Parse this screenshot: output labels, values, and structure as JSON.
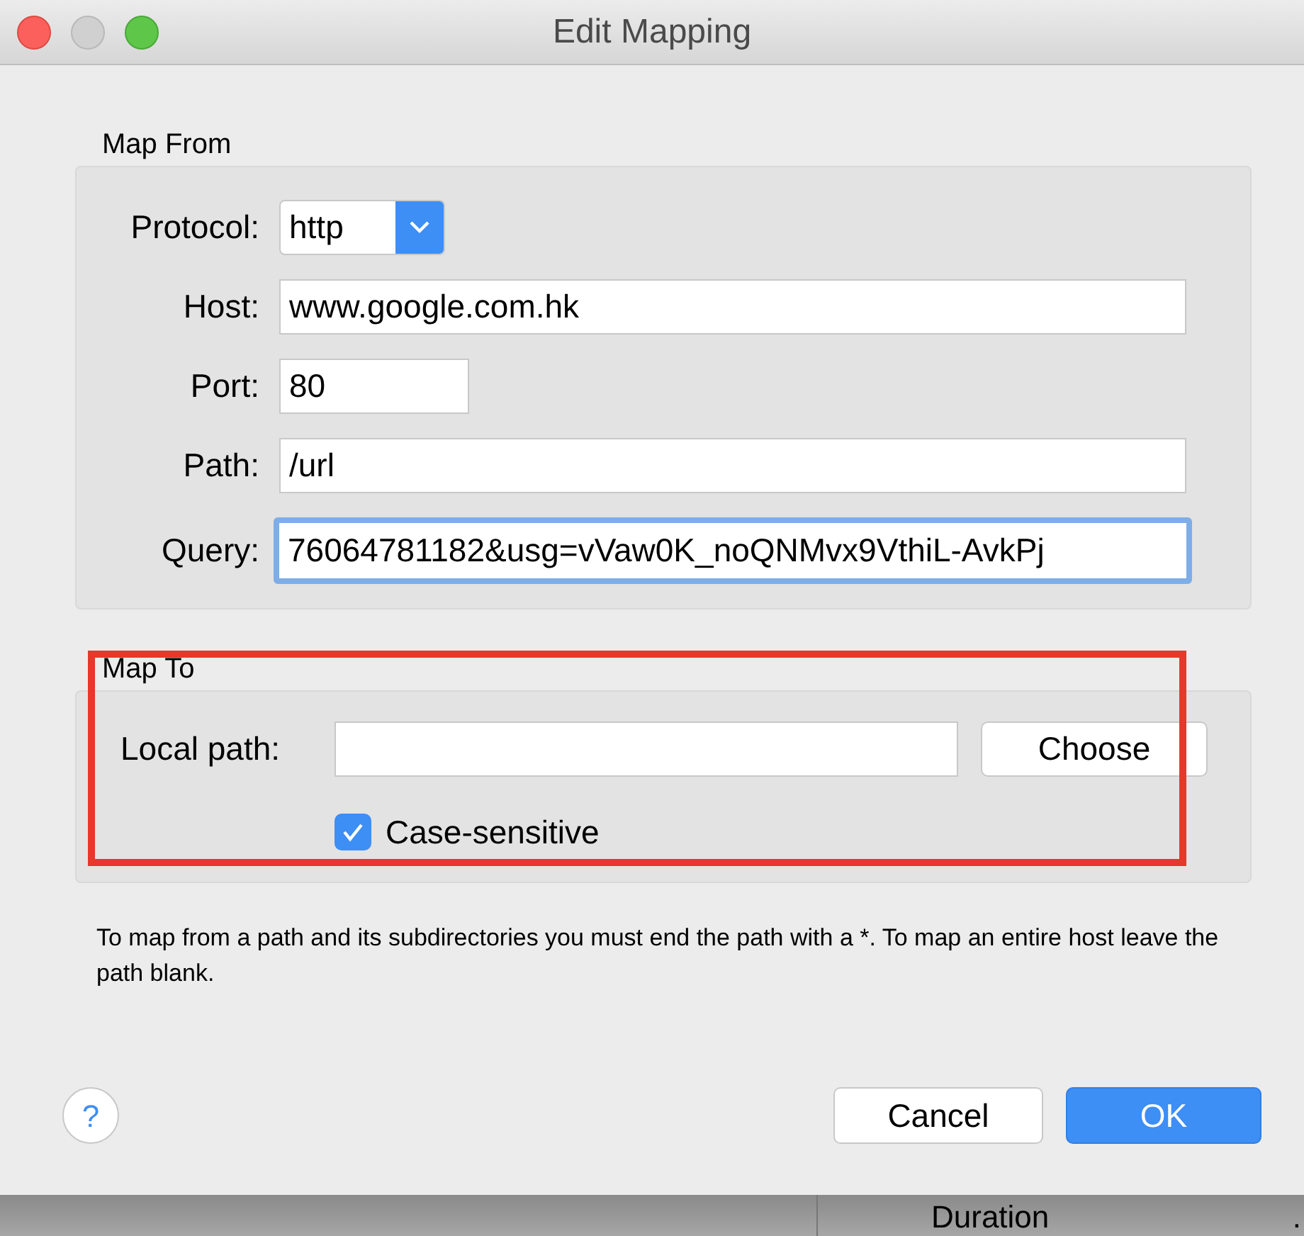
{
  "window": {
    "title": "Edit Mapping"
  },
  "map_from": {
    "title": "Map From",
    "fields": [
      {
        "kind": "select",
        "label": "Protocol:",
        "value": "http",
        "focused": false
      },
      {
        "kind": "text",
        "label": "Host:",
        "value": "www.google.com.hk",
        "focused": false
      },
      {
        "kind": "short",
        "label": "Port:",
        "value": "80",
        "focused": false
      },
      {
        "kind": "text",
        "label": "Path:",
        "value": "/url",
        "focused": false
      },
      {
        "kind": "text",
        "label": "Query:",
        "value": "76064781182&usg=vVaw0K_noQNMvx9VthiL-AvkPj",
        "focused": true
      }
    ]
  },
  "map_to": {
    "title": "Map To",
    "local_path": {
      "label": "Local path:"
    },
    "choose_button": "Choose",
    "case_sensitive": {
      "label": "Case-sensitive",
      "checked": true
    }
  },
  "annotation": {
    "color": "#e8372b"
  },
  "note": "To map from a path and its subdirectories you must end the path with a *. To map an entire host leave the path blank.",
  "help_button": "?",
  "buttons": [
    {
      "label": "Cancel",
      "default": false
    },
    {
      "label": "OK",
      "default": true
    }
  ],
  "background_window": {
    "column_header": "Duration",
    "column_2": "."
  }
}
